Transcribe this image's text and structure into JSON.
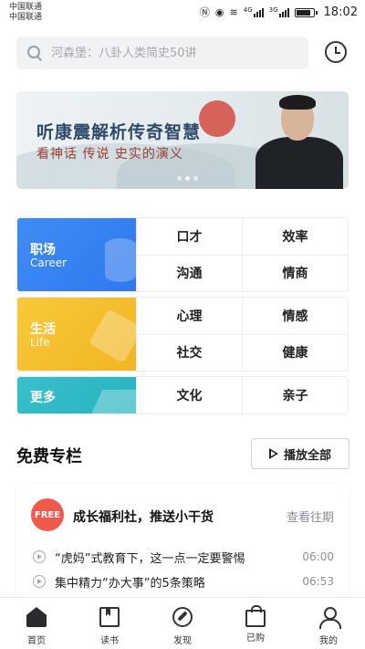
{
  "status_bar": {
    "carrier_1": "中国联通",
    "carrier_2": "中国联通",
    "network_1": "4G",
    "network_2": "3G",
    "time": "18:02",
    "battery_level": 0.75
  },
  "search": {
    "placeholder": "河森堡：八卦人类简史50讲",
    "icon": "search-icon"
  },
  "history_icon": "clock-icon",
  "banner": {
    "title": "听康震解析传奇智慧",
    "subtitle": "看神话 传说 史实的演义",
    "page_count": 3,
    "active_page": 1
  },
  "categories": [
    {
      "name": "职场",
      "english": "Career",
      "color": "#3f8cf6",
      "items": [
        "口才",
        "效率",
        "沟通",
        "情商"
      ]
    },
    {
      "name": "生活",
      "english": "Life",
      "color": "#f8c93b",
      "items": [
        "心理",
        "情感",
        "社交",
        "健康"
      ]
    },
    {
      "name": "更多",
      "english": "",
      "color": "#38c0cb",
      "items": [
        "文化",
        "亲子"
      ]
    }
  ],
  "free_section": {
    "title": "免费专栏",
    "play_all_label": "播放全部",
    "card": {
      "badge": "FREE",
      "badge_color": "#ef5a4f",
      "title": "成长福利社，推送小干货",
      "history_link": "查看往期",
      "episodes": [
        {
          "title": "“虎妈”式教育下，这一点一定要警惕",
          "duration": "06:00"
        },
        {
          "title": "集中精力“办大事”的5条策略",
          "duration": "06:53"
        }
      ]
    }
  },
  "tabbar": {
    "items": [
      {
        "label": "首页",
        "icon": "home-icon",
        "active": true
      },
      {
        "label": "读书",
        "icon": "book-icon",
        "active": false
      },
      {
        "label": "发现",
        "icon": "compass-icon",
        "active": false
      },
      {
        "label": "已购",
        "icon": "bag-icon",
        "active": false
      },
      {
        "label": "我的",
        "icon": "user-icon",
        "active": false
      }
    ]
  }
}
